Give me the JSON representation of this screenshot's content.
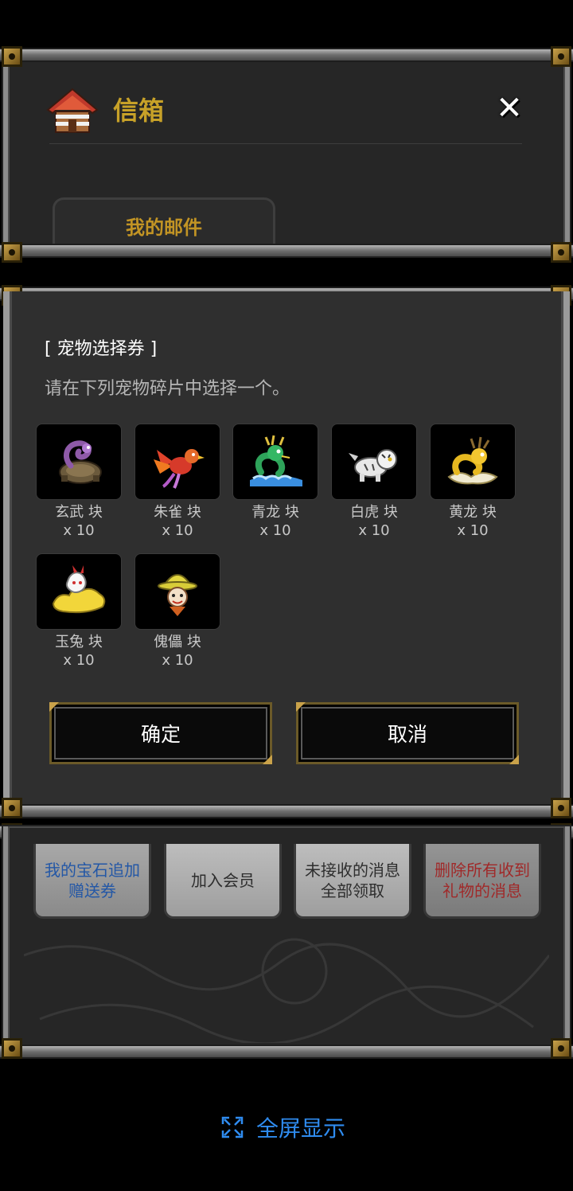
{
  "mailbox": {
    "title": "信箱",
    "tab_mine": "我的邮件",
    "buttons": [
      {
        "label": "我的宝石追加\n赠送券"
      },
      {
        "label": "加入会员"
      },
      {
        "label": "未接收的消息\n全部领取"
      },
      {
        "label": "删除所有收到\n礼物的消息"
      }
    ]
  },
  "modal": {
    "title": "[ 宠物选择券 ]",
    "description": "请在下列宠物碎片中选择一个。",
    "pets": [
      {
        "name": "玄武 块",
        "qty": "x 10",
        "icon": "black-tortoise-icon"
      },
      {
        "name": "朱雀 块",
        "qty": "x 10",
        "icon": "vermilion-bird-icon"
      },
      {
        "name": "青龙 块",
        "qty": "x 10",
        "icon": "azure-dragon-icon"
      },
      {
        "name": "白虎 块",
        "qty": "x 10",
        "icon": "white-tiger-icon"
      },
      {
        "name": "黄龙 块",
        "qty": "x 10",
        "icon": "yellow-dragon-icon"
      },
      {
        "name": "玉兔 块",
        "qty": "x 10",
        "icon": "jade-rabbit-icon"
      },
      {
        "name": "傀儡 块",
        "qty": "x 10",
        "icon": "puppet-icon"
      }
    ],
    "confirm_label": "确定",
    "cancel_label": "取消"
  },
  "system": {
    "fullscreen_label": "全屏显示"
  },
  "colors": {
    "accent_gold": "#c7a128",
    "link_blue": "#2f8cf0",
    "panel_bg": "#2f2f2f"
  }
}
